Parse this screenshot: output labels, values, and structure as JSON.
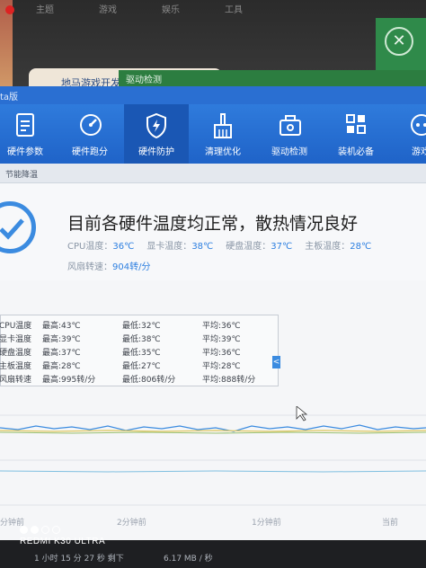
{
  "desktop": {
    "tabs": [
      "主题",
      "游戏",
      "娱乐",
      "工具"
    ],
    "behind_window_title": "地马游戏开发",
    "tooltip": "驱动检测",
    "close_icon": "close-icon"
  },
  "app": {
    "title_fragment": "ta版",
    "nav": [
      {
        "label": "硬件参数",
        "icon": "document-icon"
      },
      {
        "label": "硬件跑分",
        "icon": "gauge-icon"
      },
      {
        "label": "硬件防护",
        "icon": "shield-bolt-icon",
        "active": true
      },
      {
        "label": "清理优化",
        "icon": "broom-icon"
      },
      {
        "label": "驱动检测",
        "icon": "toolbox-icon"
      },
      {
        "label": "装机必备",
        "icon": "apps-grid-icon"
      },
      {
        "label": "游戏",
        "icon": "game-icon"
      }
    ],
    "subtab": "节能降温",
    "headline": "目前各硬件温度均正常，散热情况良好",
    "temps": [
      {
        "label": "CPU温度：",
        "value": "36℃"
      },
      {
        "label": "显卡温度：",
        "value": "38℃"
      },
      {
        "label": "硬盘温度：",
        "value": "37℃"
      },
      {
        "label": "主板温度：",
        "value": "28℃"
      }
    ],
    "fan": {
      "label": "风扇转速：",
      "value": "904转/分"
    },
    "stats": [
      {
        "name": "CPU温度",
        "max": "最高:43℃",
        "min": "最低:32℃",
        "avg": "平均:36℃"
      },
      {
        "name": "显卡温度",
        "max": "最高:39℃",
        "min": "最低:38℃",
        "avg": "平均:39℃"
      },
      {
        "name": "硬盘温度",
        "max": "最高:37℃",
        "min": "最低:35℃",
        "avg": "平均:36℃"
      },
      {
        "name": "主板温度",
        "max": "最高:28℃",
        "min": "最低:27℃",
        "avg": "平均:28℃"
      },
      {
        "name": "风扇转速",
        "max": "最高:995转/分",
        "min": "最低:806转/分",
        "avg": "平均:888转/分"
      }
    ],
    "collapse_glyph": "<",
    "x_labels": [
      "分钟前",
      "2分钟前",
      "1分钟前",
      "当前"
    ]
  },
  "watermark": {
    "device": "REDMI K30 ULTRA"
  },
  "bottom": {
    "left": "1 小时 15 分 27 秒 剩下",
    "right": "6.17 MB / 秒"
  },
  "colors": {
    "accent": "#2f7bdc",
    "value_blue": "#2d7fe0"
  }
}
